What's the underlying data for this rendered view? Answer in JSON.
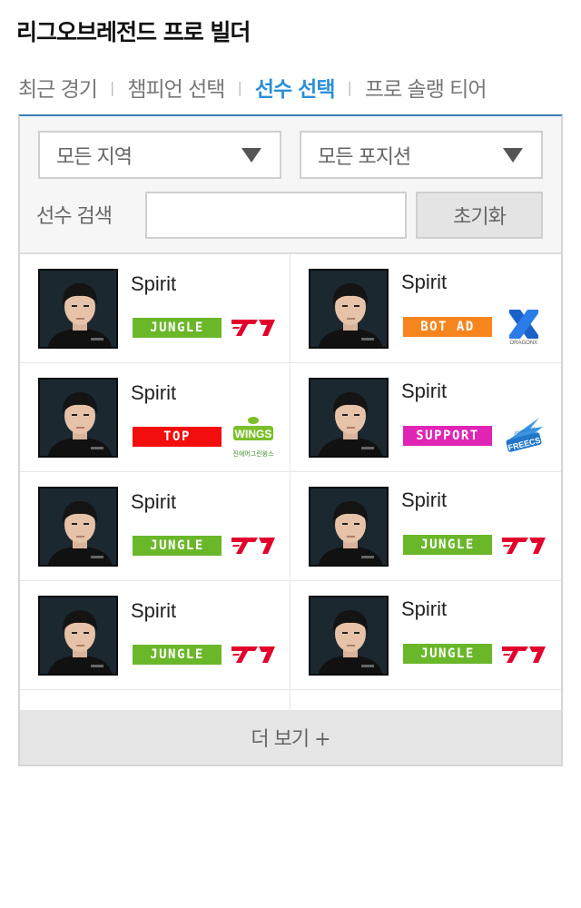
{
  "app": {
    "title": "리그오브레전드 프로 빌더"
  },
  "tabs": [
    {
      "label": "최근 경기",
      "active": false
    },
    {
      "label": "챔피언 선택",
      "active": false
    },
    {
      "label": "선수 선택",
      "active": true
    },
    {
      "label": "프로 솔랭 티어",
      "active": false
    }
  ],
  "filters": {
    "region": "모든 지역",
    "position": "모든 포지션",
    "search_label": "선수 검색",
    "search_value": "",
    "reset_label": "초기화"
  },
  "players": [
    {
      "name": "Spirit",
      "role": "JUNGLE",
      "team": "T1"
    },
    {
      "name": "Spirit",
      "role": "BOT AD",
      "team": "DRX"
    },
    {
      "name": "Spirit",
      "role": "TOP",
      "team": "Jin Air Green Wings"
    },
    {
      "name": "Spirit",
      "role": "SUPPORT",
      "team": "Afreeca Freecs"
    },
    {
      "name": "Spirit",
      "role": "JUNGLE",
      "team": "T1"
    },
    {
      "name": "Spirit",
      "role": "JUNGLE",
      "team": "T1"
    },
    {
      "name": "Spirit",
      "role": "JUNGLE",
      "team": "T1"
    },
    {
      "name": "Spirit",
      "role": "JUNGLE",
      "team": "T1"
    }
  ],
  "role_colors": {
    "JUNGLE": "#6ab72a",
    "BOT AD": "#f7851e",
    "TOP": "#f30e0e",
    "SUPPORT": "#e024b4"
  },
  "team_logo_text": {
    "drx": "DRAGONX",
    "jag_main": "WINGS",
    "jag_sub": "진에어그린윙스",
    "afreeca_top": "AfreecaTV",
    "afreeca_main": "FREECS"
  },
  "more_button": {
    "label": "더 보기 +"
  },
  "colors": {
    "accent": "#2d8fd8",
    "border": "#3c7fb9"
  }
}
